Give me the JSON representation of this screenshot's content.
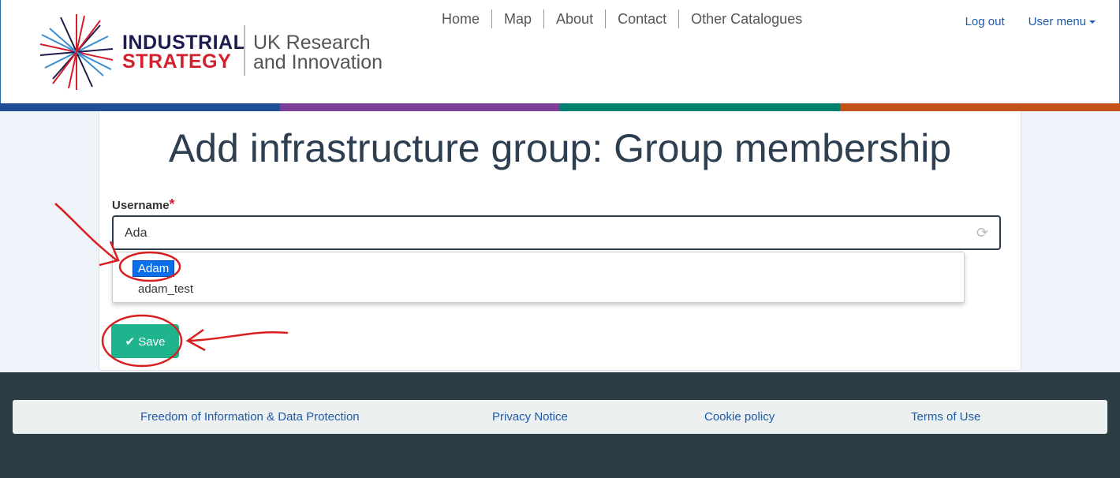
{
  "header": {
    "logo": {
      "line1": "INDUSTRIAL",
      "line2": "STRATEGY",
      "org1": "UK Research",
      "org2": "and Innovation"
    },
    "nav": [
      "Home",
      "Map",
      "About",
      "Contact",
      "Other Catalogues"
    ],
    "logout": "Log out",
    "user_menu": "User menu"
  },
  "stripe_colors": [
    "#1f4e96",
    "#7e3f98",
    "#00806e",
    "#c4501a"
  ],
  "main": {
    "title": "Add infrastructure group: Group membership",
    "username_label": "Username",
    "required_mark": "*",
    "username_value": "Ada",
    "suggestions": [
      "Adam",
      "adam_test"
    ],
    "save_label": "Save"
  },
  "footer": {
    "links": [
      "Freedom of Information & Data Protection",
      "Privacy Notice",
      "Cookie policy",
      "Terms of Use"
    ]
  }
}
